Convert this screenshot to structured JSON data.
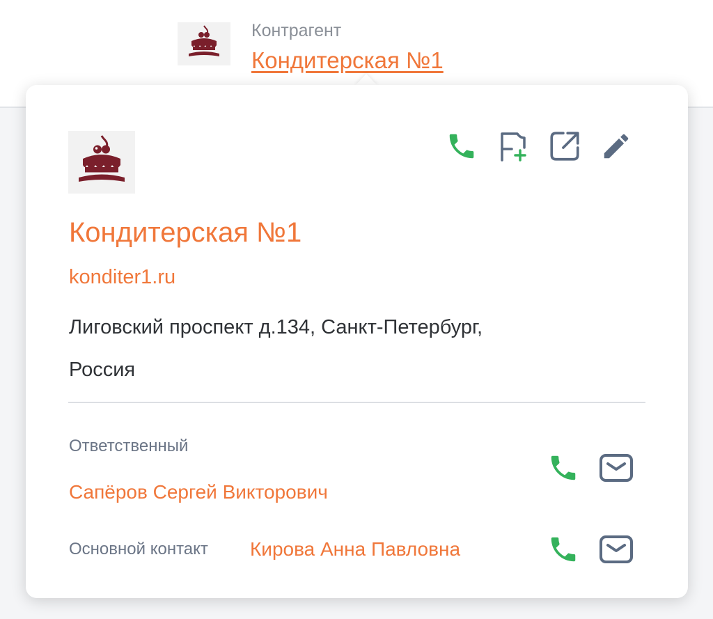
{
  "header": {
    "label": "Контрагент",
    "company_link": "Кондитерская №1",
    "logo_icon": "cake-icon"
  },
  "card": {
    "logo_icon": "cake-icon",
    "actions": [
      {
        "icon": "phone-icon",
        "color": "#34b25b"
      },
      {
        "icon": "flag-add-icon",
        "color": "#5b6b82"
      },
      {
        "icon": "external-link-icon",
        "color": "#5b6b82"
      },
      {
        "icon": "pencil-icon",
        "color": "#5b6b82"
      }
    ],
    "company_name": "Кондитерская №1",
    "website": "konditer1.ru",
    "address_line1": "Лиговский проспект д.134, Санкт-Петербург,",
    "address_line2": "Россия",
    "responsible": {
      "label": "Ответственный",
      "name": "Сапёров Сергей Викторович"
    },
    "main_contact": {
      "label": "Основной контакт",
      "name": "Кирова Анна Павловна"
    }
  },
  "colors": {
    "accent": "#f0773a",
    "phone": "#34b25b",
    "icon": "#5b6b82",
    "cake": "#7a1f2b"
  }
}
